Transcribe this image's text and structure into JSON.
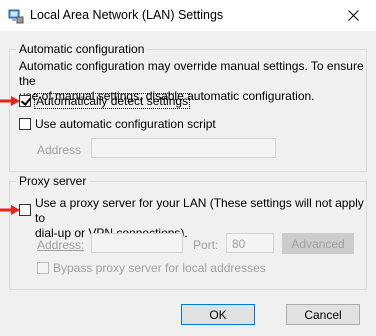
{
  "window": {
    "title": "Local Area Network (LAN) Settings",
    "icon": "network-settings-icon",
    "close_icon": "close-icon"
  },
  "auto_config": {
    "legend": "Automatic configuration",
    "description_line1": "Automatic configuration may override manual settings.  To ensure the",
    "description_line2": "use of manual settings, disable automatic configuration.",
    "auto_detect": {
      "label": "Automatically detect settings",
      "checked": true
    },
    "use_script": {
      "label": "Use automatic configuration script",
      "checked": false
    },
    "address_label": "Address",
    "address_value": ""
  },
  "proxy": {
    "legend": "Proxy server",
    "use_proxy_line1": "Use a proxy server for your LAN (These settings will not apply to",
    "use_proxy_line2": "dial-up or VPN connections).",
    "use_proxy_checked": false,
    "address_label": "Address:",
    "address_value": "",
    "port_label": "Port:",
    "port_value": "80",
    "advanced_label": "Advanced",
    "bypass_label": "Bypass proxy server for local addresses",
    "bypass_checked": false
  },
  "buttons": {
    "ok": "OK",
    "cancel": "Cancel"
  },
  "colors": {
    "annotation_arrow": "#e8231b",
    "default_button_border": "#0078d7"
  }
}
